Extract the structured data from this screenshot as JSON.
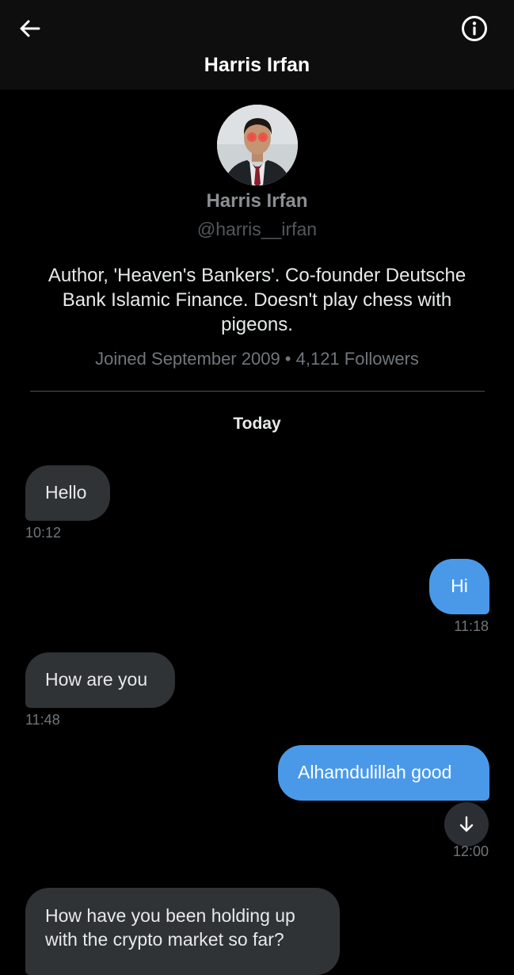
{
  "header": {
    "title": "Harris Irfan"
  },
  "profile": {
    "name": "Harris Irfan",
    "handle": "@harris__irfan",
    "bio": "Author, 'Heaven's Bankers'. Co-founder Deutsche Bank Islamic Finance. Doesn't play chess with pigeons.",
    "meta": "Joined September 2009 • 4,121 Followers"
  },
  "conversation": {
    "day_label": "Today",
    "messages": [
      {
        "direction": "in",
        "text": "Hello",
        "time": "10:12"
      },
      {
        "direction": "out",
        "text": "Hi",
        "time": "11:18"
      },
      {
        "direction": "in",
        "text": "How are you",
        "time": "11:48"
      },
      {
        "direction": "out",
        "text": "Alhamdulillah good",
        "time": "12:00"
      },
      {
        "direction": "in",
        "text": "How have you been holding up with the crypto market so far?",
        "time": ""
      }
    ]
  },
  "icons": {
    "back": "arrow-left-icon",
    "info": "info-circle-icon",
    "scroll_down": "arrow-down-icon"
  },
  "colors": {
    "outgoing_bubble": "#4a99e9",
    "incoming_bubble": "#2f3336",
    "background": "#000000",
    "avatar_eye_glow": "#ff2a2a"
  }
}
